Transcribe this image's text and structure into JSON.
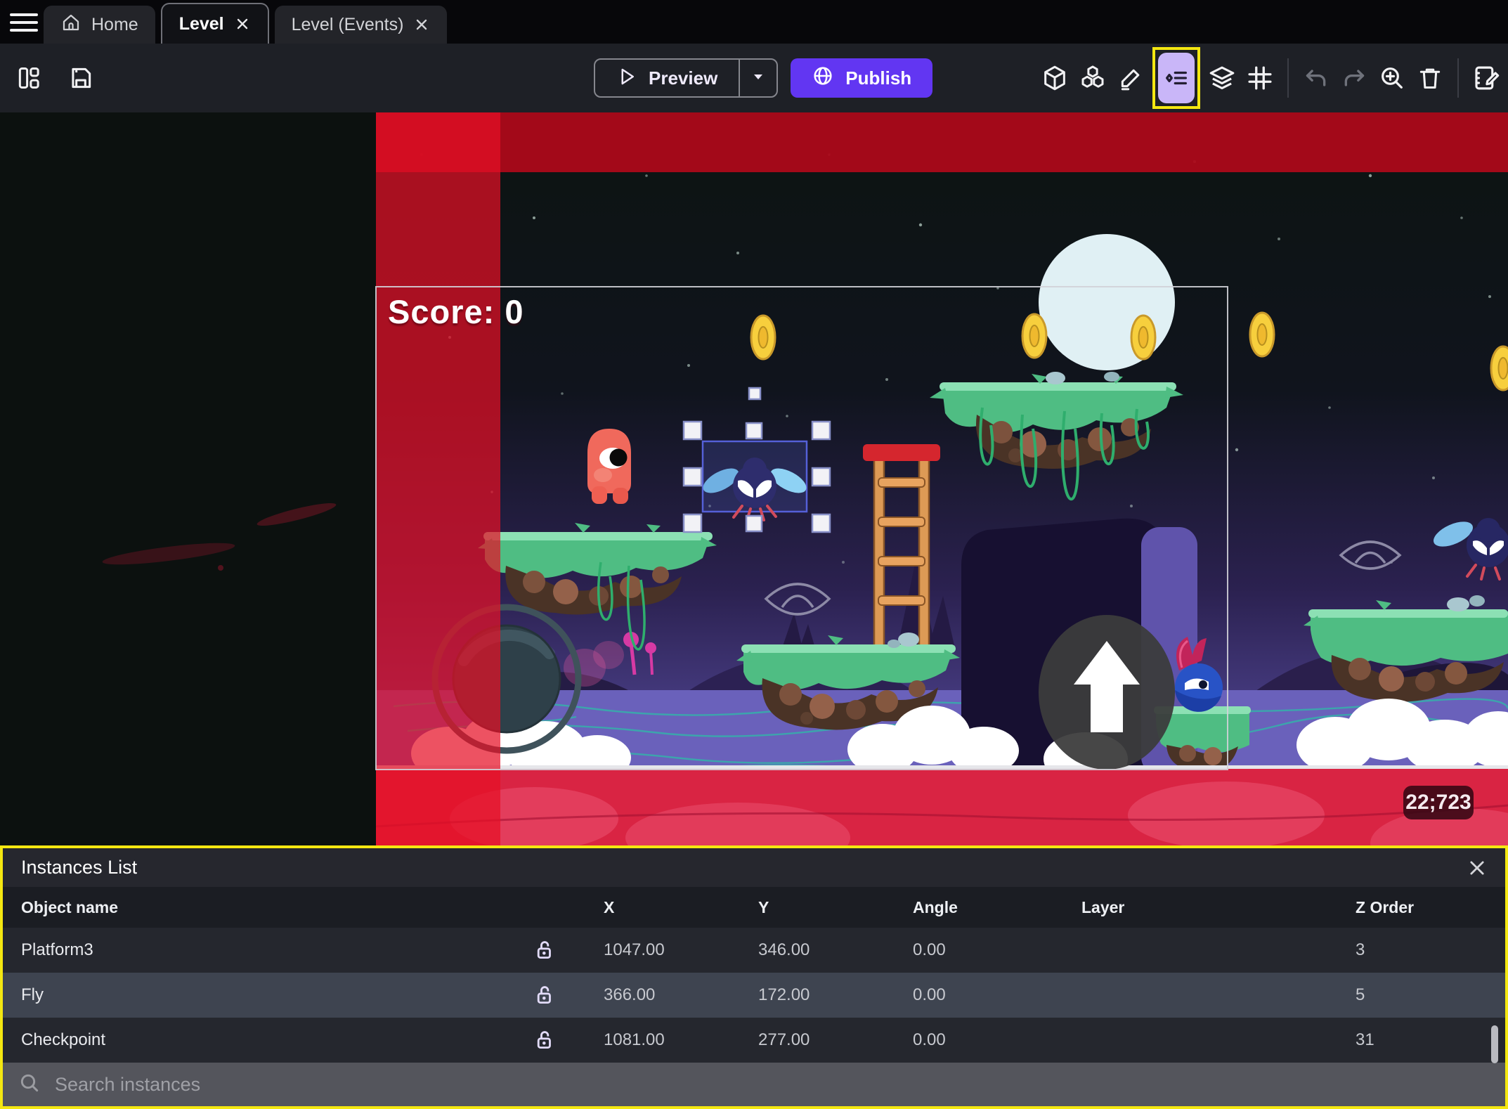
{
  "tab_bar": {
    "tabs": [
      {
        "label": "Home"
      },
      {
        "label": "Level"
      },
      {
        "label": "Level (Events)"
      }
    ]
  },
  "toolbar": {
    "preview_label": "Preview",
    "publish_label": "Publish",
    "icons": [
      "objects-panel",
      "object-groups",
      "edit-mode",
      "instances-list",
      "layers",
      "grid",
      "undo",
      "redo",
      "zoom-in",
      "delete",
      "scene-properties"
    ]
  },
  "scene": {
    "score_label": "Score: 0",
    "cursor_coords": "22;723"
  },
  "instances_panel": {
    "title": "Instances List",
    "columns": {
      "name": "Object name",
      "x": "X",
      "y": "Y",
      "angle": "Angle",
      "layer": "Layer",
      "z_order": "Z Order"
    },
    "rows": [
      {
        "name": "Platform3",
        "x": "1047.00",
        "y": "346.00",
        "angle": "0.00",
        "layer": "",
        "z_order": "3",
        "selected": false
      },
      {
        "name": "Fly",
        "x": "366.00",
        "y": "172.00",
        "angle": "0.00",
        "layer": "",
        "z_order": "5",
        "selected": true
      },
      {
        "name": "Checkpoint",
        "x": "1081.00",
        "y": "277.00",
        "angle": "0.00",
        "layer": "",
        "z_order": "31",
        "selected": false
      }
    ],
    "search_placeholder": "Search instances"
  },
  "colors": {
    "accent_purple": "#6236f2",
    "highlight_yellow": "#f4e711",
    "selection_light_purple": "#c9b6f8",
    "danger_red": "#e01226",
    "selected_row": "#3e4450"
  }
}
